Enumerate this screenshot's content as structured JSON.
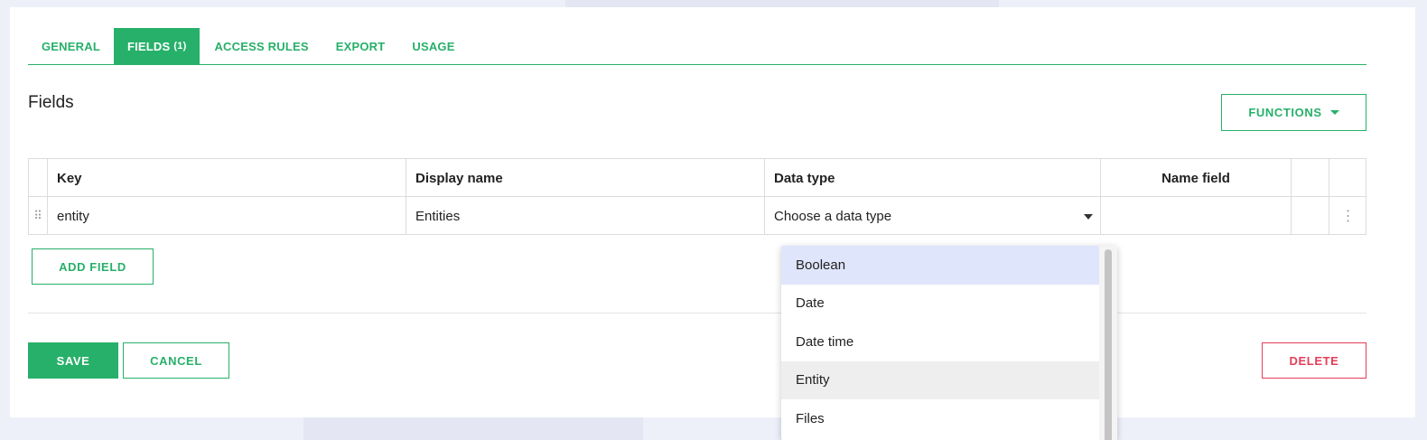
{
  "tabs": [
    {
      "label": "GENERAL"
    },
    {
      "label": "FIELDS",
      "count": "(1)",
      "active": true
    },
    {
      "label": "ACCESS RULES"
    },
    {
      "label": "EXPORT"
    },
    {
      "label": "USAGE"
    }
  ],
  "section": {
    "title": "Fields"
  },
  "functions_button": {
    "label": "FUNCTIONS"
  },
  "table": {
    "headers": {
      "key": "Key",
      "display_name": "Display name",
      "data_type": "Data type",
      "name_field": "Name field"
    },
    "rows": [
      {
        "key": "entity",
        "display_name": "Entities",
        "data_type_placeholder": "Choose a data type",
        "name_field": ""
      }
    ]
  },
  "add_field_button": {
    "label": "ADD FIELD"
  },
  "footer": {
    "save_label": "SAVE",
    "cancel_label": "CANCEL",
    "delete_label": "DELETE"
  },
  "dropdown": {
    "options": [
      "Boolean",
      "Date",
      "Date time",
      "Entity",
      "Files"
    ],
    "highlighted": "Boolean",
    "hovered": "Entity"
  },
  "colors": {
    "accent": "#27b06a",
    "danger": "#e33e5a",
    "highlight": "#dfe5fb"
  },
  "icons": {
    "drag_handle": "drag-handle-icon",
    "row_menu": "more-vertical-icon",
    "dropdown": "caret-down-icon"
  }
}
